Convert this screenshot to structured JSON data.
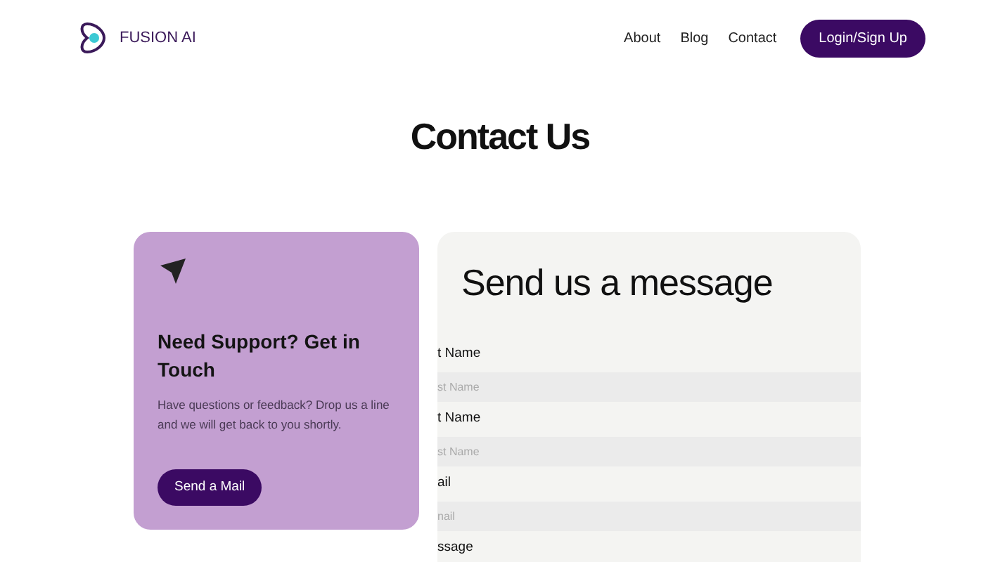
{
  "header": {
    "brand": "FUSION AI",
    "nav": [
      "About",
      "Blog",
      "Contact"
    ],
    "login_button": "Login/Sign Up"
  },
  "page_title": "Contact Us",
  "support_card": {
    "title": "Need Support? Get in Touch",
    "text": "Have questions or feedback? Drop us a line and we will get back to you shortly.",
    "button": "Send a Mail"
  },
  "message_form": {
    "title": "Send us a message",
    "fields": [
      {
        "label": "t Name",
        "placeholder": "st Name"
      },
      {
        "label": "t Name",
        "placeholder": "st Name"
      },
      {
        "label": "ail",
        "placeholder": "nail"
      },
      {
        "label": "ssage"
      }
    ]
  }
}
